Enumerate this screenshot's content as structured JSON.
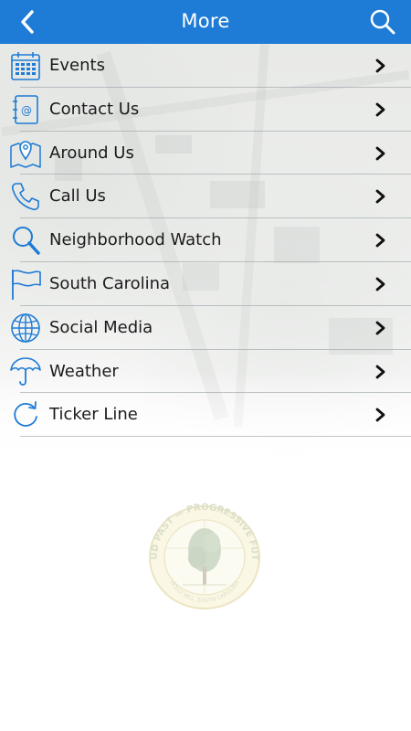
{
  "header": {
    "title": "More",
    "background": "#1e7bd6",
    "back_icon": "chevron-left-icon",
    "search_icon": "search-icon"
  },
  "menu": {
    "items": [
      {
        "label": "Events",
        "icon": "calendar-icon"
      },
      {
        "label": "Contact Us",
        "icon": "address-book-icon"
      },
      {
        "label": "Around Us",
        "icon": "map-pin-icon"
      },
      {
        "label": "Call Us",
        "icon": "phone-icon"
      },
      {
        "label": "Neighborhood Watch",
        "icon": "magnifier-icon"
      },
      {
        "label": "South Carolina",
        "icon": "flag-icon"
      },
      {
        "label": "Social Media",
        "icon": "globe-icon"
      },
      {
        "label": "Weather",
        "icon": "umbrella-icon"
      },
      {
        "label": "Ticker Line",
        "icon": "refresh-icon"
      }
    ],
    "icon_color": "#1e7bd6"
  },
  "seal": {
    "top_text": "PROUD PAST — PROGRESSIVE FUTURE",
    "bottom_text": "HOLLY HILL, SOUTH CAROLINA",
    "icon": "tree-seal-icon"
  }
}
